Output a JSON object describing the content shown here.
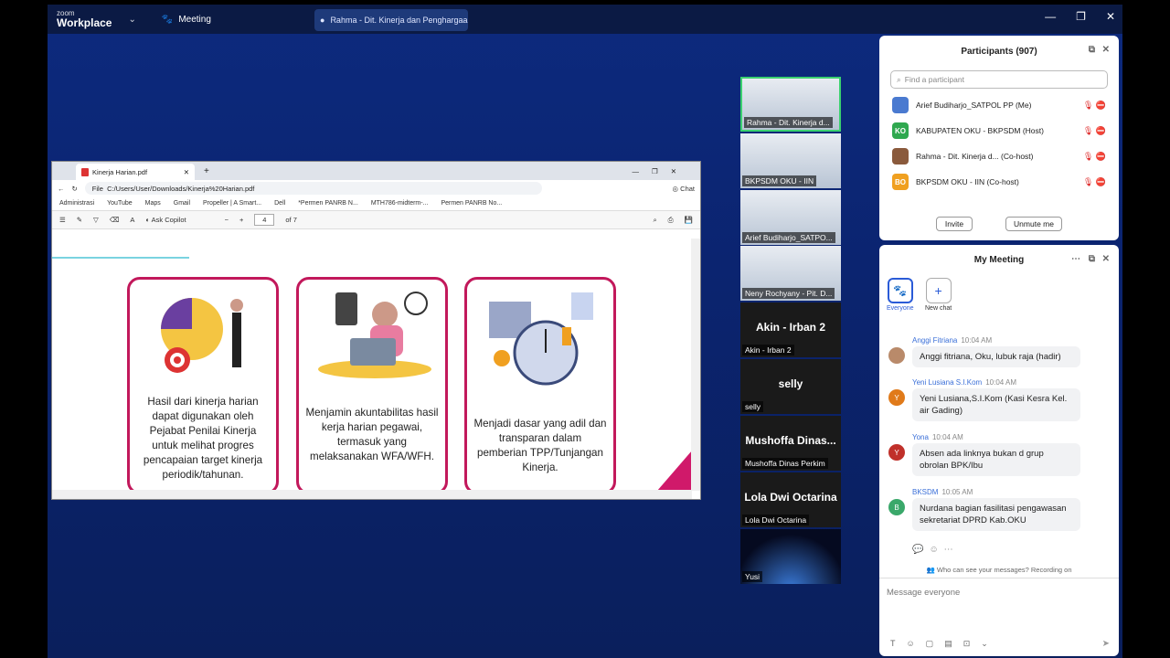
{
  "app": {
    "logo_top": "zoom",
    "logo_bottom": "Workplace",
    "meeting_tab": "Meeting",
    "share_tab": "Rahma - Dit. Kinerja dan Penghargaan"
  },
  "browser": {
    "tab_title": "Kinerja Harian.pdf",
    "url_prefix": "File",
    "url": "C:/Users/User/Downloads/Kinerja%20Harian.pdf",
    "chat_label": "Chat",
    "bookmarks": [
      "Administrasi",
      "YouTube",
      "Maps",
      "Gmail",
      "Propeller | A Smart...",
      "Dell",
      "*Permen PANRB N...",
      "MTH786-midterm-...",
      "Permen PANRB No..."
    ],
    "pdf_toolbar": {
      "copilot": "Ask Copilot",
      "page": "4",
      "of": "of 7"
    }
  },
  "slide": {
    "cards": [
      {
        "text": "Hasil dari kinerja harian dapat digunakan oleh Pejabat Penilai Kinerja untuk melihat progres pencapaian target kinerja periodik/tahunan."
      },
      {
        "text": "Menjamin akuntabilitas hasil kerja harian pegawai, termasuk yang melaksanakan WFA/WFH."
      },
      {
        "text": "Menjadi dasar yang adil dan transparan dalam pemberian TPP/Tunjangan Kinerja."
      }
    ]
  },
  "tiles": [
    {
      "name": "Rahma - Dit. Kinerja d...",
      "big": ""
    },
    {
      "name": "BKPSDM OKU - IIN",
      "big": ""
    },
    {
      "name": "Arief Budiharjo_SATPO...",
      "big": ""
    },
    {
      "name": "Neny Rochyany - Pit. D...",
      "big": ""
    },
    {
      "name": "Akin - Irban 2",
      "big": "Akin - Irban 2"
    },
    {
      "name": "selly",
      "big": "selly"
    },
    {
      "name": "Mushoffa Dinas Perkim",
      "big": "Mushoffa Dinas..."
    },
    {
      "name": "Lola Dwi Octarina",
      "big": "Lola Dwi Octarina"
    },
    {
      "name": "Yusi",
      "big": ""
    }
  ],
  "participants": {
    "title": "Participants (907)",
    "search_placeholder": "Find a participant",
    "rows": [
      {
        "initials": "",
        "name": "Arief Budiharjo_SATPOL PP (Me)",
        "color": "#4a7ad0"
      },
      {
        "initials": "KO",
        "name": "KABUPATEN OKU - BKPSDM (Host)",
        "color": "#2fa84f"
      },
      {
        "initials": "",
        "name": "Rahma - Dit. Kinerja d... (Co-host)",
        "color": "#8a5a3c"
      },
      {
        "initials": "BO",
        "name": "BKPSDM OKU - IIN (Co-host)",
        "color": "#f0a020"
      }
    ],
    "invite": "Invite",
    "unmute": "Unmute me"
  },
  "chat": {
    "title": "My Meeting",
    "tabs": {
      "everyone": "Everyone",
      "new_chat": "New chat"
    },
    "messages": [
      {
        "sender": "Anggi Fitriana",
        "time": "10:04 AM",
        "text": "Anggi fitriana, Oku, lubuk raja (hadir)",
        "initial": "",
        "color": "#b98a6a"
      },
      {
        "sender": "Yeni Lusiana S.I.Kom",
        "time": "10:04 AM",
        "text": "Yeni Lusiana,S.I.Kom (Kasi Kesra Kel. air Gading)",
        "initial": "Y",
        "color": "#e07a1a"
      },
      {
        "sender": "Yona",
        "time": "10:04 AM",
        "text": "Absen ada linknya bukan d grup obrolan BPK/Ibu",
        "initial": "Y",
        "color": "#c0302a"
      },
      {
        "sender": "BKSDM",
        "time": "10:05 AM",
        "text": "Nurdana bagian fasilitasi pengawasan sekretariat DPRD Kab.OKU",
        "initial": "B",
        "color": "#3aa86a"
      }
    ],
    "notice": "Who can see your messages? Recording on",
    "input_placeholder": "Message everyone"
  }
}
